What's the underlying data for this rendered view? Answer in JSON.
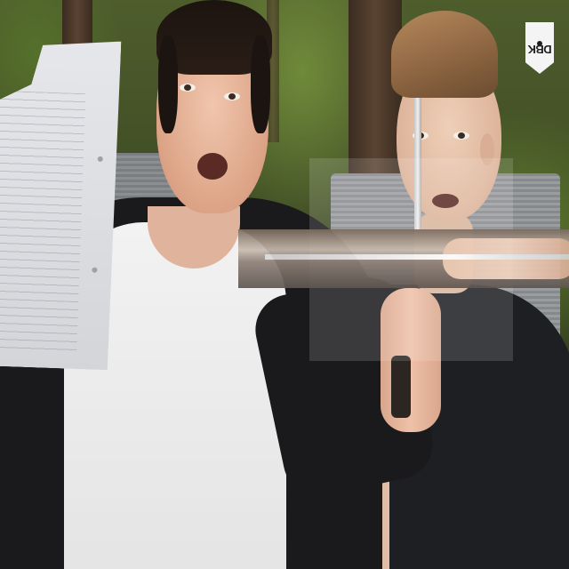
{
  "image": {
    "logo": {
      "text": "DBK"
    }
  }
}
